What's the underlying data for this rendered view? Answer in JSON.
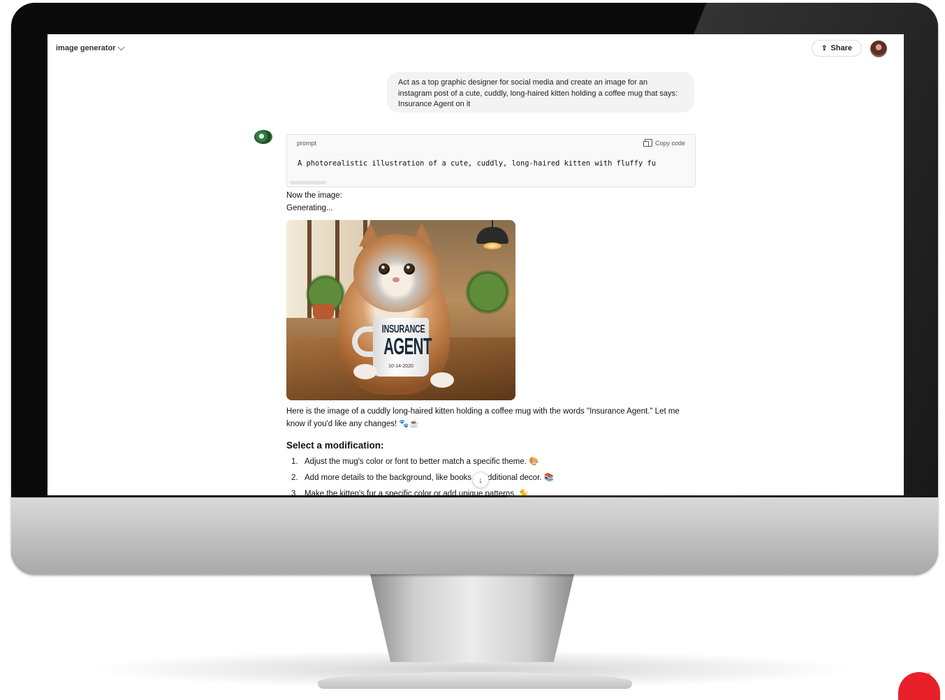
{
  "header": {
    "model_label": "image generator",
    "share_label": "Share"
  },
  "conversation": {
    "user_message": "Act as a top graphic designer for social media and create an image for an instagram post of a cute, cuddly, long-haired kitten holding a coffee mug that says: Insurance Agent on it",
    "code_block": {
      "language": "prompt",
      "copy_label": "Copy code",
      "code": "A photorealistic illustration of a cute, cuddly, long-haired kitten with fluffy fu"
    },
    "now_image_text": "Now the image:",
    "generating_text": "Generating...",
    "image": {
      "mug_line1": "INSURANCE",
      "mug_line2": "AGENT",
      "mug_date": "10-14-2020"
    },
    "reply_text": "Here is the image of a cuddly long-haired kitten holding a coffee mug with the words \"Insurance Agent.\" Let me know if you'd like any changes! 🐾☕",
    "section_heading": "Select a modification:",
    "modifications": [
      {
        "num": "1.",
        "text": "Adjust the mug's color or font to better match a specific theme. 🎨"
      },
      {
        "num": "2.",
        "text": "Add more details to the background, like books or additional decor. 📚"
      },
      {
        "num": "3.",
        "text": "Make the kitten's fur a specific color or add unique patterns. 🐈"
      }
    ]
  },
  "icons": {
    "share": "share-icon",
    "copy": "copy-icon",
    "scroll": "arrow-down-icon"
  },
  "colors": {
    "user_bubble": "#f3f3f3",
    "brand_logo": "#e8202a"
  }
}
